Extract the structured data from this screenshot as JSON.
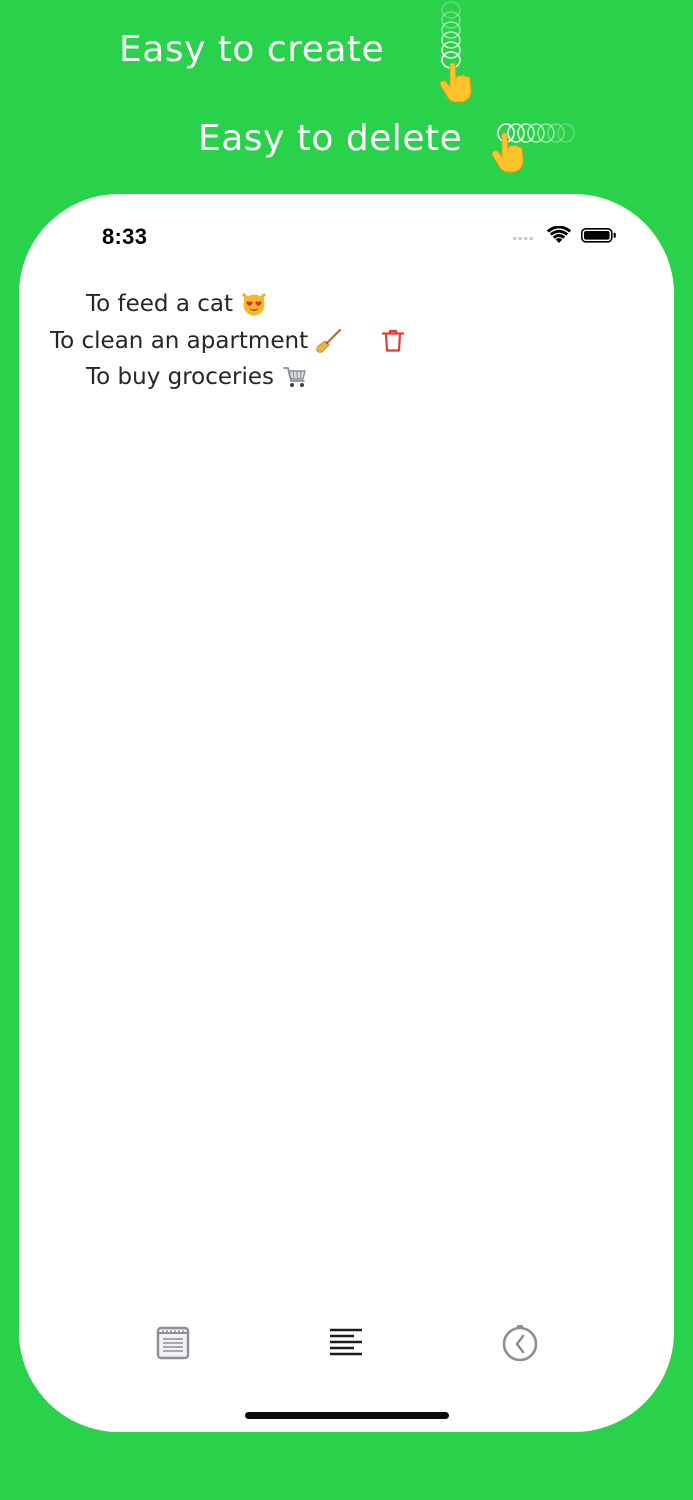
{
  "promo": {
    "create_caption": "Easy to create",
    "delete_caption": "Easy to delete"
  },
  "status_bar": {
    "time": "8:33"
  },
  "todos": [
    {
      "text": "To feed a cat",
      "emoji_icon": "heart-eyes-cat-emoji"
    },
    {
      "text": "To clean an apartment",
      "emoji_icon": "broom-emoji",
      "swiped": true
    },
    {
      "text": "To buy groceries",
      "emoji_icon": "shopping-cart-emoji"
    }
  ],
  "tab_bar": {
    "tabs": [
      {
        "icon": "notepad-icon",
        "active": false
      },
      {
        "icon": "list-lines-icon",
        "active": true
      },
      {
        "icon": "clock-history-icon",
        "active": false
      }
    ]
  },
  "colors": {
    "background": "#2AD14A",
    "delete_red": "#E53935",
    "inactive_tab": "#8E8E93",
    "active_tab": "#1C1C1E"
  }
}
